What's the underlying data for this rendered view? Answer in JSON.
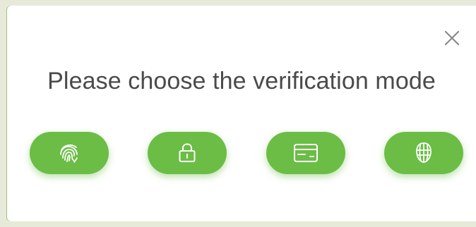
{
  "dialog": {
    "title": "Please choose the verification mode",
    "close_icon": "close-icon"
  },
  "modes": [
    {
      "icon": "fingerprint-icon"
    },
    {
      "icon": "lock-icon"
    },
    {
      "icon": "card-icon"
    },
    {
      "icon": "face-icon"
    }
  ],
  "colors": {
    "accent": "#6bbd45",
    "title_text": "#4a4a4a",
    "close_icon": "#8a8a8a",
    "background": "#ffffff"
  }
}
